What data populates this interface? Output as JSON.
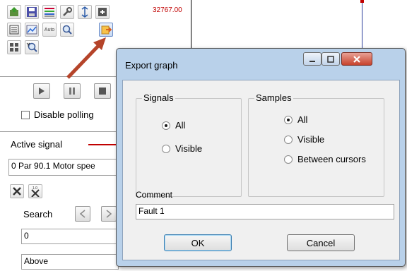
{
  "plot": {
    "max_value_label": "32767.00"
  },
  "left_panel": {
    "disable_polling_label": "Disable polling",
    "active_signal_label": "Active signal",
    "active_signal_value": "0 Par 90.1 Motor spee",
    "search_label": "Search",
    "search_value": "0",
    "condition_value": "Above",
    "toolbar_auto_label": "Auto"
  },
  "dialog": {
    "title": "Export graph",
    "signals": {
      "title": "Signals",
      "options": [
        {
          "label": "All",
          "selected": true
        },
        {
          "label": "Visible",
          "selected": false
        }
      ]
    },
    "samples": {
      "title": "Samples",
      "options": [
        {
          "label": "All",
          "selected": true
        },
        {
          "label": "Visible",
          "selected": false
        },
        {
          "label": "Between cursors",
          "selected": false
        }
      ]
    },
    "comment_label": "Comment",
    "comment_value": "Fault 1",
    "ok_label": "OK",
    "cancel_label": "Cancel"
  },
  "colors": {
    "arrow": "#b5442a",
    "dialog_frame": "#b9d1ea",
    "plot_label": "#c00000"
  }
}
